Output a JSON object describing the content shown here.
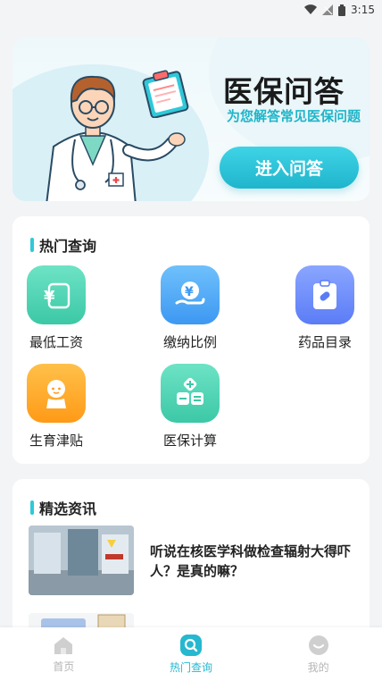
{
  "status_bar": {
    "time": "3:15"
  },
  "banner": {
    "title": "医保问答",
    "subtitle": "为您解答常见医保问题",
    "button_label": "进入问答"
  },
  "hot": {
    "title": "热门查询",
    "items": [
      {
        "label": "最低工资",
        "icon": "yuan-slip-icon",
        "color": "#4fd2b3"
      },
      {
        "label": "缴纳比例",
        "icon": "yuan-hand-icon",
        "color": "#4fa8f6"
      },
      {
        "label": "药品目录",
        "icon": "pill-clipboard-icon",
        "color": "#6d8ef9"
      },
      {
        "label": "生育津贴",
        "icon": "baby-icon",
        "color": "#ffad2e"
      },
      {
        "label": "医保计算",
        "icon": "calculator-icon",
        "color": "#4fd2b3"
      }
    ]
  },
  "news": {
    "title": "精选资讯",
    "items": [
      {
        "title": "听说在核医学科做检查辐射大得吓人？是真的嘛？"
      },
      {
        "title": ""
      }
    ]
  },
  "tabbar": {
    "tabs": [
      {
        "label": "首页",
        "icon": "home-icon"
      },
      {
        "label": "热门查询",
        "icon": "search-icon"
      },
      {
        "label": "我的",
        "icon": "profile-icon"
      }
    ],
    "active_color": "#25b8cf",
    "inactive_color": "#b5b5b5"
  }
}
